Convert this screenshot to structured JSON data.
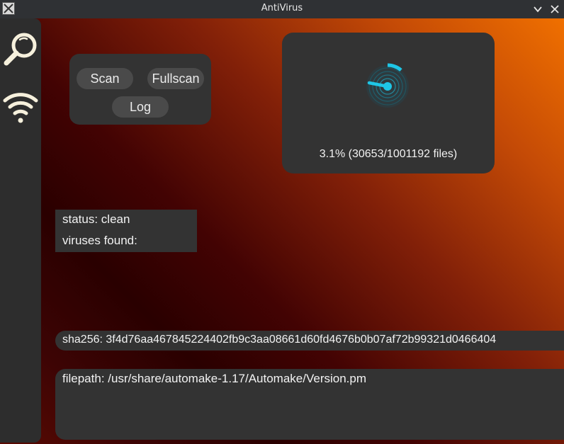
{
  "window": {
    "title": "AntiVirus"
  },
  "sidebar": {
    "items": [
      {
        "icon": "search-icon"
      },
      {
        "icon": "wifi-icon"
      }
    ]
  },
  "scan_panel": {
    "scan_label": "Scan",
    "fullscan_label": "Fullscan",
    "log_label": "Log"
  },
  "progress": {
    "percent": 3.1,
    "files_scanned": 30653,
    "files_total": 1001192,
    "label": "3.1% (30653/1001192 files)"
  },
  "status": {
    "status_line": "status: clean",
    "viruses_line": "viruses found:"
  },
  "file_info": {
    "sha256_line": "sha256: 3f4d76aa467845224402fb9c3aa08661d60fd4676b0b07af72b99321d0466404",
    "filepath_line": "filepath: /usr/share/automake-1.17/Automake/Version.pm"
  },
  "colors": {
    "accent": "#1ec6e6",
    "panel": "#333333",
    "sidebar": "#2d2d2d",
    "icon": "#f6f0dc",
    "gradient_light": "#f07000",
    "gradient_dark": "#2a0000"
  }
}
